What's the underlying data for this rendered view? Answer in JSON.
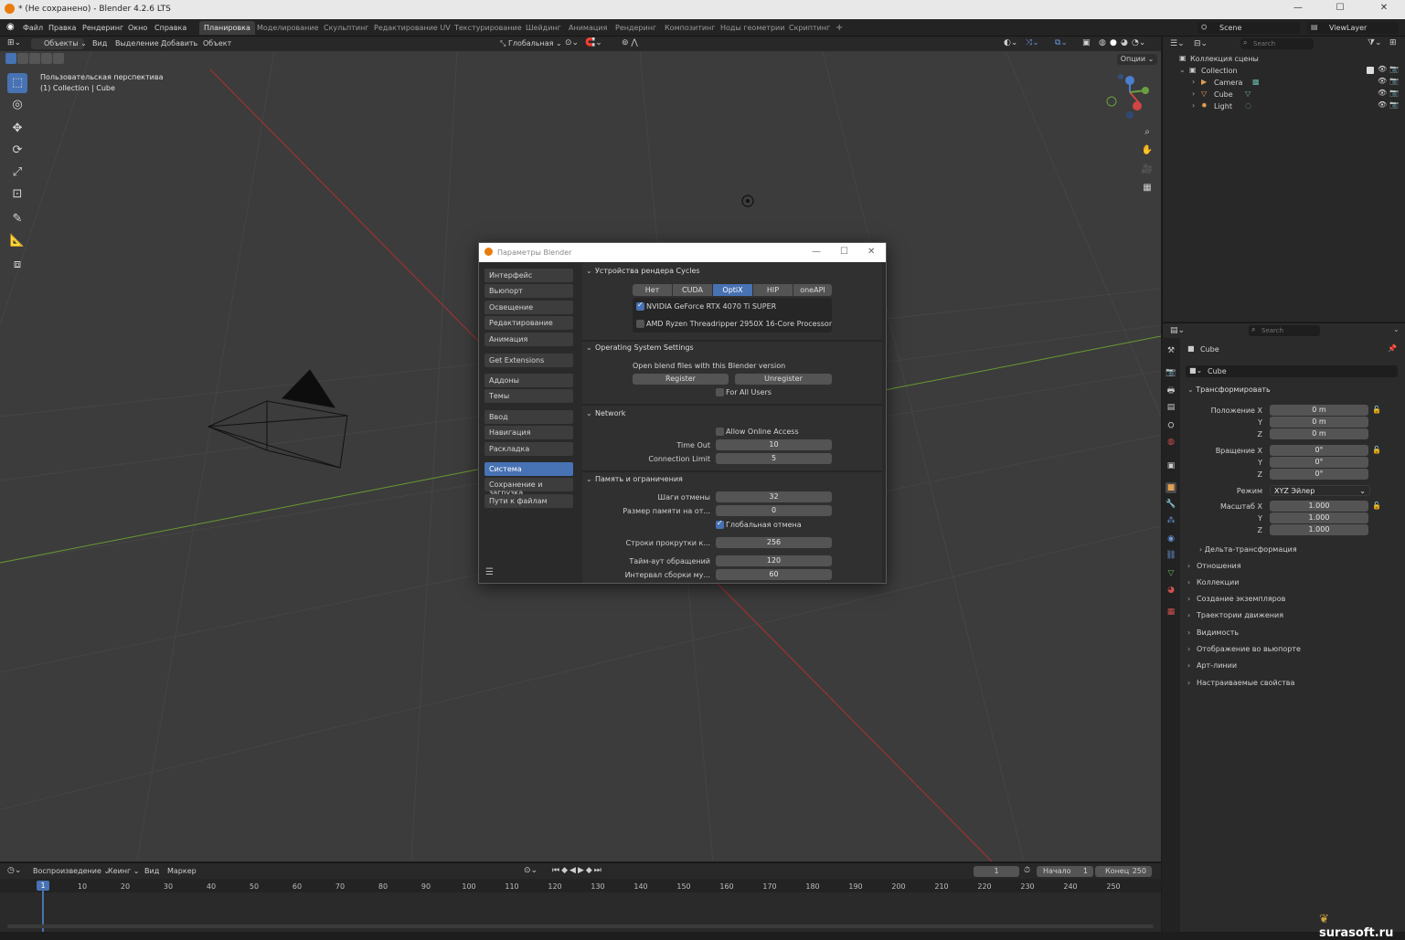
{
  "window": {
    "title": "* (Не сохранено) - Blender 4.2.6 LTS"
  },
  "menu": [
    "Файл",
    "Правка",
    "Рендеринг",
    "Окно",
    "Справка"
  ],
  "workspaces": [
    "Планировка",
    "Моделирование",
    "Скульптинг",
    "Редактирование UV",
    "Текстурирование",
    "Шейдинг",
    "Анимация",
    "Рендеринг",
    "Композитинг",
    "Ноды геометрии",
    "Скриптинг"
  ],
  "scene": {
    "name": "Scene",
    "viewlayer": "ViewLayer"
  },
  "viewport": {
    "mode": "Объекты",
    "menus": [
      "Вид",
      "Выделение",
      "Добавить",
      "Объект"
    ],
    "orientation": "Глобальная",
    "options": "Опции",
    "overlay_title": "Пользовательская перспектива",
    "overlay_collection": "(1) Collection | Cube"
  },
  "outliner": {
    "search_placeholder": "Search",
    "scene_collection": "Коллекция сцены",
    "collection": "Collection",
    "items": [
      "Camera",
      "Cube",
      "Light"
    ]
  },
  "properties": {
    "search_placeholder": "Search",
    "object_name": "Cube",
    "object_field": "Cube",
    "transform_title": "Трансформировать",
    "location_label": "Положение X",
    "location": [
      "0 m",
      "0 m",
      "0 m"
    ],
    "rotation_label": "Вращение X",
    "rotation": [
      "0°",
      "0°",
      "0°"
    ],
    "mode_label": "Режим",
    "mode_value": "XYZ Эйлер",
    "scale_label": "Масштаб X",
    "scale": [
      "1.000",
      "1.000",
      "1.000"
    ],
    "axis_y": "Y",
    "axis_z": "Z",
    "delta": "Дельта-трансформация",
    "sections": [
      "Отношения",
      "Коллекции",
      "Создание экземпляров",
      "Траектории движения",
      "Видимость",
      "Отображение во вьюпорте",
      "Арт-линии",
      "Настраиваемые свойства"
    ]
  },
  "timeline": {
    "menus": [
      "Воспроизведение",
      "Кеинг",
      "Вид",
      "Маркер"
    ],
    "current_frame": "1",
    "start_label": "Начало",
    "start": "1",
    "end_label": "Конец",
    "end": "250",
    "ticks": [
      "10",
      "20",
      "30",
      "40",
      "50",
      "60",
      "70",
      "80",
      "90",
      "100",
      "110",
      "120",
      "130",
      "140",
      "150",
      "160",
      "170",
      "180",
      "190",
      "200",
      "210",
      "220",
      "230",
      "240",
      "250"
    ],
    "playhead": "1"
  },
  "dialog": {
    "title": "Параметры Blender",
    "nav": [
      "Интерфейс",
      "Вьюпорт",
      "Освещение",
      "Редактирование",
      "Анимация",
      "Get Extensions",
      "Аддоны",
      "Темы",
      "Ввод",
      "Навигация",
      "Раскладка",
      "Система",
      "Сохранение и загрузка",
      "Пути к файлам"
    ],
    "active_nav": "Система",
    "cycles": {
      "title": "Устройства рендера Cycles",
      "tabs": [
        "Нет",
        "CUDA",
        "OptiX",
        "HIP",
        "oneAPI"
      ],
      "active_tab": "OptiX",
      "devices": [
        {
          "name": "NVIDIA GeForce RTX 4070 Ti SUPER",
          "checked": true
        },
        {
          "name": "AMD Ryzen Threadripper 2950X 16-Core Processor",
          "checked": false
        }
      ]
    },
    "os": {
      "title": "Operating System Settings",
      "text": "Open blend files with this Blender version",
      "register": "Register",
      "unregister": "Unregister",
      "all_users": "For All Users"
    },
    "network": {
      "title": "Network",
      "online": "Allow Online Access",
      "timeout_label": "Time Out",
      "timeout": "10",
      "limit_label": "Connection Limit",
      "limit": "5"
    },
    "memory": {
      "title": "Память и ограничения",
      "undo_label": "Шаги отмены",
      "undo": "32",
      "undo_mem_label": "Размер памяти на от...",
      "undo_mem": "0",
      "global_undo": "Глобальная отмена",
      "scroll_label": "Строки прокрутки к...",
      "scroll": "256",
      "timeout_label": "Тайм-аут обращений",
      "timeout": "120",
      "gc_label": "Интервал сборки му...",
      "gc": "60"
    }
  },
  "watermark": "surasoft.ru",
  "colors": {
    "accent": "#4772b3",
    "x_axis": "#b03030",
    "y_axis": "#6a9a30"
  }
}
